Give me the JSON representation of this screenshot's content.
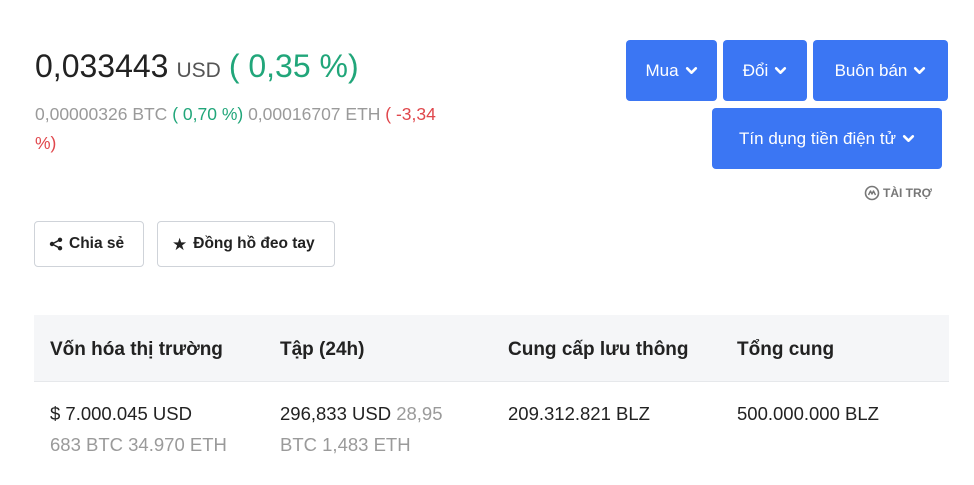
{
  "price": {
    "value": "0,033443",
    "unit": "USD",
    "change": "( 0,35 %)",
    "btc_value": "0,00000326 BTC",
    "btc_change": "( 0,70 %)",
    "eth_value": "0,00016707 ETH",
    "eth_change": "( -3,34 %)"
  },
  "actions": {
    "buy": "Mua",
    "exchange": "Đổi",
    "trade": "Buôn bán",
    "crypto_credit": "Tín dụng tiền điện tử",
    "sponsored": "TÀI TRỢ"
  },
  "social": {
    "share": "Chia sẻ",
    "watchlist": "Đồng hồ đeo tay"
  },
  "stats": {
    "headers": [
      "Vốn hóa thị trường",
      "Tập (24h)",
      "Cung cấp lưu thông",
      "Tổng cung"
    ],
    "market_cap_usd": "$ 7.000.045 USD",
    "market_cap_alt": "683 BTC 34.970 ETH",
    "volume_usd": "296,833 USD",
    "volume_alt": "28,95 BTC 1,483 ETH",
    "circulating": "209.312.821 BLZ",
    "total_supply": "500.000.000 BLZ"
  },
  "colors": {
    "accent": "#3b76f3",
    "positive": "#21a67a",
    "negative": "#e0474c"
  }
}
